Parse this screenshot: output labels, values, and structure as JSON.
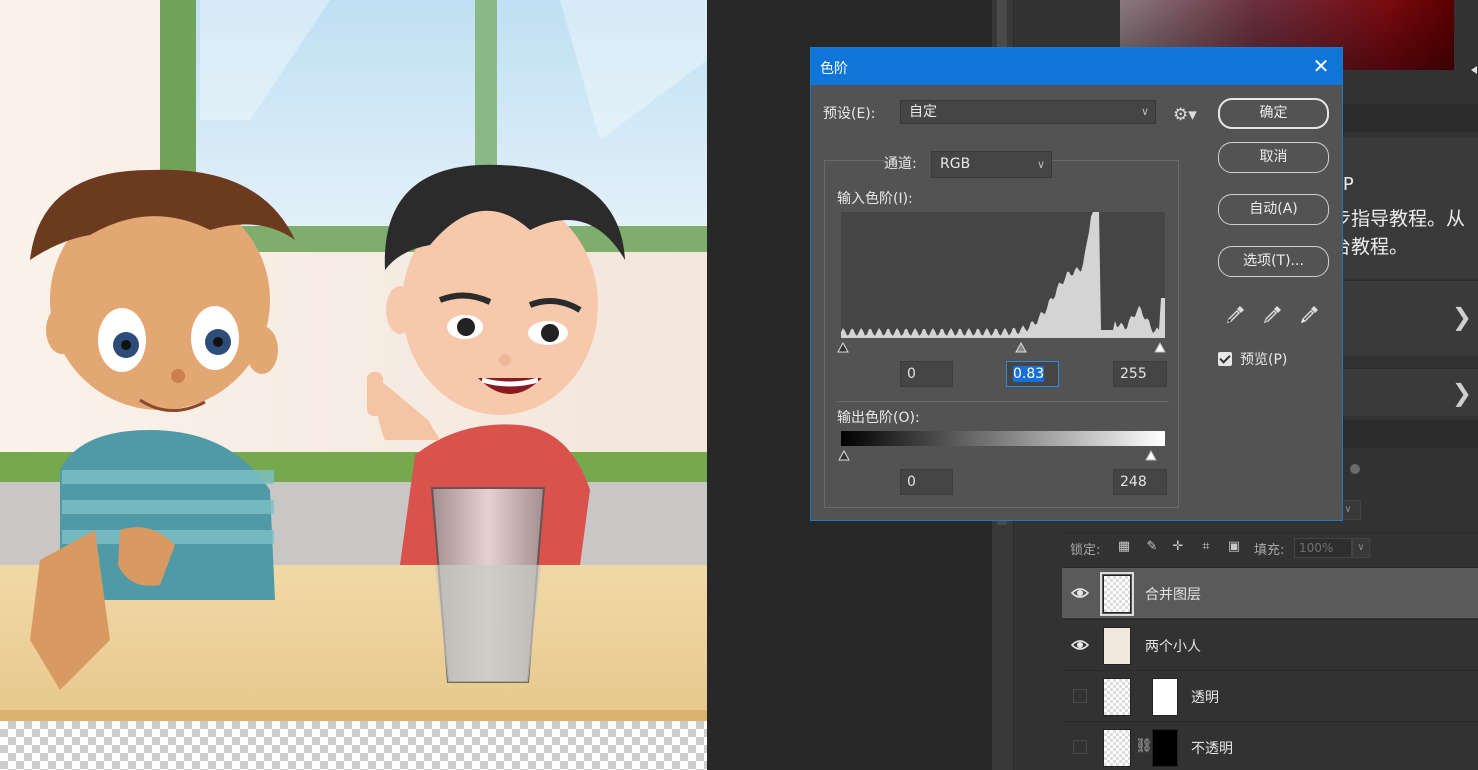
{
  "dialog": {
    "title": "色阶",
    "preset_label": "预设(E):",
    "preset_value": "自定",
    "channel_label": "通道:",
    "channel_value": "RGB",
    "input_levels_label": "输入色阶(I):",
    "output_levels_label": "输出色阶(O):",
    "input_black": "0",
    "input_gamma": "0.83",
    "input_white": "255",
    "output_black": "0",
    "output_white": "248",
    "ok_label": "确定",
    "cancel_label": "取消",
    "auto_label": "自动(A)",
    "options_label": "选项(T)...",
    "preview_label": "预览(P)",
    "preview_checked": true,
    "close_icon": "close-icon",
    "gear_icon": "gear-icon"
  },
  "learn_panel": {
    "line1": "PP",
    "line2": "步指导教程。从",
    "line3": "台教程。"
  },
  "layers_panel": {
    "lock_label": "锁定:",
    "fill_label": "填充:",
    "fill_value": "100%",
    "layers": [
      {
        "name": "合并图层",
        "visible": true,
        "selected": true
      },
      {
        "name": "两个小人",
        "visible": true,
        "selected": false
      },
      {
        "name": "透明",
        "visible": false,
        "selected": false
      },
      {
        "name": "不透明",
        "visible": false,
        "selected": false
      }
    ]
  },
  "colors": {
    "dialog_titlebar": "#0f76d8",
    "dialog_bg": "#535353",
    "panel_bg": "#323232"
  }
}
